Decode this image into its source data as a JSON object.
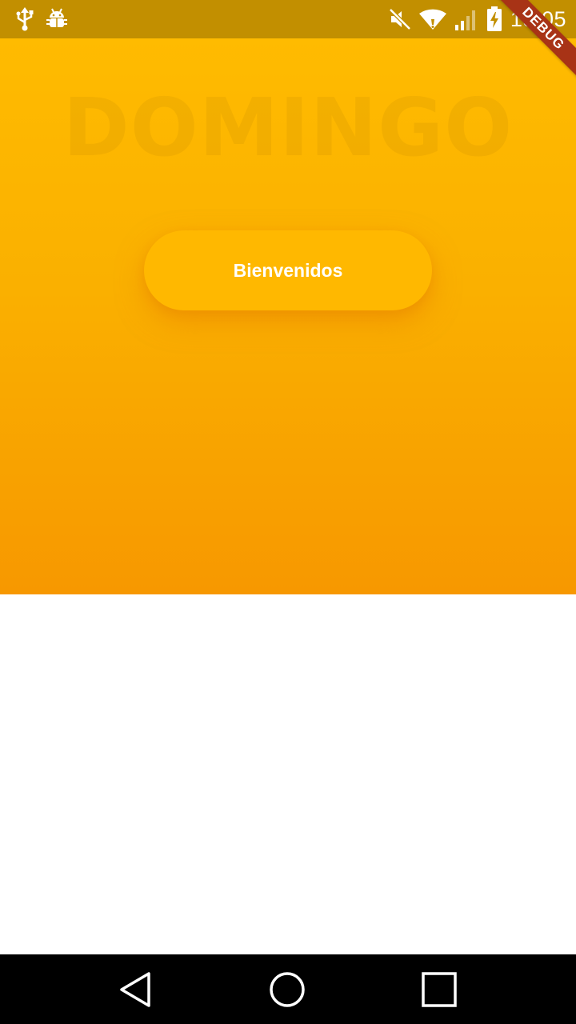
{
  "status_bar": {
    "time": "18:05",
    "left_icons": [
      "usb-icon",
      "android-debug-icon"
    ],
    "right_icons": [
      "mute-icon",
      "wifi-icon",
      "signal-icon",
      "battery-charging-icon"
    ],
    "background": "#c28f00"
  },
  "debug_banner": {
    "label": "DEBUG",
    "color": "#a83316"
  },
  "hero": {
    "title": "DOMINGO",
    "welcome_label": "Bienvenidos",
    "gradient_top": "#ffbb00",
    "gradient_bottom": "#f79800",
    "button_color": "#ffb800"
  },
  "nav_bar": {
    "icons": [
      "back-icon",
      "home-icon",
      "recents-icon"
    ]
  }
}
